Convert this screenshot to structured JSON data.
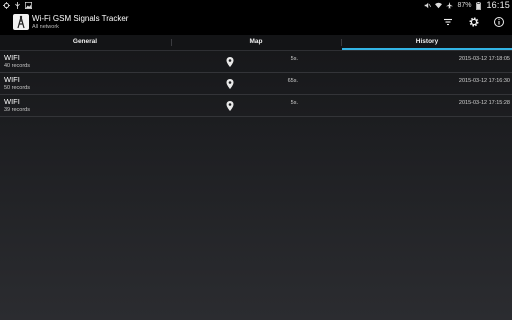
{
  "status_bar": {
    "battery_text": "87%",
    "clock": "16:15"
  },
  "action_bar": {
    "title": "Wi-Fi GSM Signals Tracker",
    "subtitle": "All network",
    "actions": [
      {
        "name": "filter-icon"
      },
      {
        "name": "settings-icon"
      },
      {
        "name": "info-icon"
      }
    ]
  },
  "tabs": [
    {
      "label": "General",
      "selected": false
    },
    {
      "label": "Map",
      "selected": false
    },
    {
      "label": "History",
      "selected": true
    }
  ],
  "accent_color": "#33b5e5",
  "rows": [
    {
      "title": "WIFI",
      "count": "40 records",
      "duration": "5s.",
      "date": "2015-03-12 17:18:05"
    },
    {
      "title": "WIFI",
      "count": "50 records",
      "duration": "65s.",
      "date": "2015-03-12 17:16:30"
    },
    {
      "title": "WIFI",
      "count": "39 records",
      "duration": "5s.",
      "date": "2015-03-12 17:15:28"
    }
  ]
}
